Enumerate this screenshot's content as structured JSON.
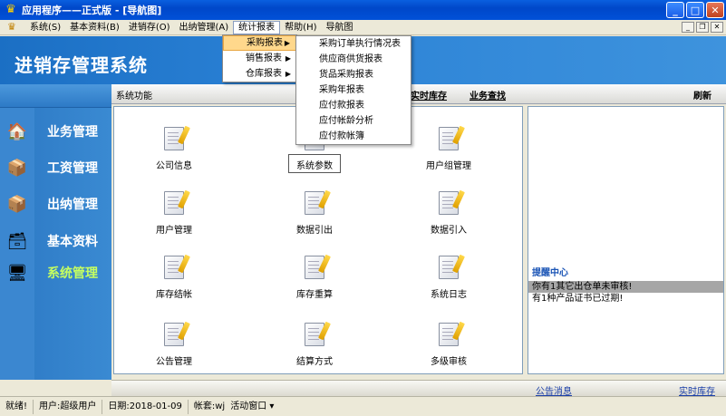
{
  "window": {
    "title": "应用程序——正式版 - [导航图]"
  },
  "menubar": {
    "items": [
      "系统(S)",
      "基本资料(B)",
      "进销存(O)",
      "出纳管理(A)",
      "统计报表",
      "帮助(H)",
      "导航图"
    ]
  },
  "banner": {
    "title": "进销存管理系统"
  },
  "leftnav": {
    "items": [
      "业务管理",
      "工资管理",
      "出纳管理",
      "基本资料",
      "系统管理"
    ],
    "active": "系统管理"
  },
  "main_header": {
    "label": "系统功能",
    "links": [
      "实时库存",
      "业务查找"
    ],
    "refresh": "刷新"
  },
  "functions": [
    "公司信息",
    "系统参数",
    "用户组管理",
    "用户管理",
    "数据引出",
    "数据引入",
    "库存结帐",
    "库存重算",
    "系统日志",
    "公告管理",
    "结算方式",
    "多级审核"
  ],
  "reminder": {
    "title": "提醒中心",
    "rows": [
      "你有1其它出仓单未审核!",
      "有1种产品证书已过期!"
    ]
  },
  "bottom_links": [
    "公告消息",
    "实时库存"
  ],
  "statusbar": {
    "ready": "就绪!",
    "user": "用户:超级用户",
    "date": "日期:2018-01-09",
    "account": "帐套:wj",
    "active_window": "活动窗口"
  },
  "stats_menu": {
    "items": [
      "采购报表",
      "销售报表",
      "仓库报表"
    ],
    "hover": "采购报表"
  },
  "purchase_submenu": {
    "items": [
      "采购订单执行情况表",
      "供应商供货报表",
      "货品采购报表",
      "采购年报表",
      "应付款报表",
      "应付帐龄分析",
      "应付款帐簿"
    ]
  }
}
